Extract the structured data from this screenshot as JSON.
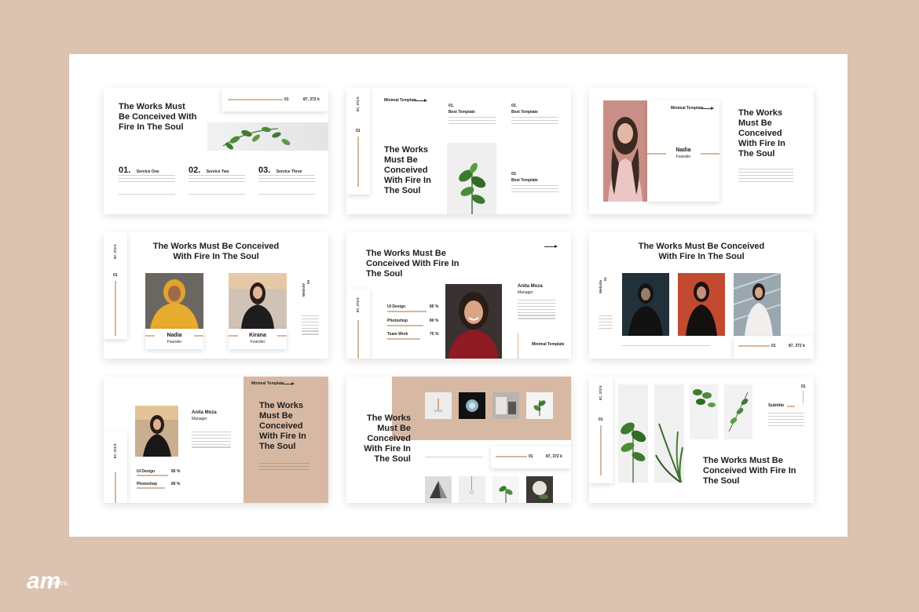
{
  "colors": {
    "background": "#dcc2b0",
    "accent": "#d8b79a",
    "board": "#ffffff"
  },
  "logo": {
    "text": "am",
    "sub": "slides."
  },
  "common": {
    "title_full": "The Works Must Be Conceived With Fire In The Soul",
    "minimal_template": "Minimal Template",
    "stat": "87, 372 k",
    "stat_short": "01"
  },
  "s1": {
    "title": "The Works Must Be Conceived With Fire In The Soul",
    "stat": "87, 372 k",
    "stat_small": "01",
    "services": [
      {
        "num": "01.",
        "label": "Service One"
      },
      {
        "num": "02.",
        "label": "Service Two"
      },
      {
        "num": "03.",
        "label": "Service Three"
      }
    ]
  },
  "s2": {
    "title": "The Works Must Be Conceived With Fire In The Soul",
    "header": "Minimal Template",
    "side_stat": "87, 372 k",
    "side_num": "01",
    "items": [
      {
        "num": "01.",
        "label": "Best Template"
      },
      {
        "num": "02.",
        "label": "Best Template"
      },
      {
        "num": "03.",
        "label": "Best Template"
      }
    ]
  },
  "s3": {
    "title": "The Works Must Be Conceived With Fire In The Soul",
    "header": "Minimal Template",
    "name": "Nadia",
    "role": "Founder"
  },
  "s4": {
    "title": "The Works Must Be Conceived With Fire In The Soul",
    "side_stat": "87, 372 k",
    "side_num": "01",
    "right_label": "Website",
    "right_num": "05",
    "people": [
      {
        "name": "Nadia",
        "role": "Founder"
      },
      {
        "name": "Kirana",
        "role": "Founder"
      }
    ]
  },
  "s5": {
    "title": "The Works Must Be Conceived With Fire In The Soul",
    "name": "Anita Moza",
    "role": "Manager",
    "side_stat": "87, 372 k",
    "footer": "Minimal Template",
    "skills": [
      {
        "label": "UI Design",
        "value": "85 %"
      },
      {
        "label": "Photoshop",
        "value": "80 %"
      },
      {
        "label": "Team Work",
        "value": "75 %"
      }
    ]
  },
  "s6": {
    "title": "The Works Must Be Conceived With Fire In The Soul",
    "side_label": "Website",
    "side_num": "01",
    "stat": "87, 372 k",
    "stat_small": "01"
  },
  "s7": {
    "title": "The Works Must Be Conceived With Fire In The Soul",
    "header": "Minimal Template",
    "name": "Anita Moza",
    "role": "Manager",
    "side_stat": "87, 372 k",
    "skills": [
      {
        "label": "UI Design",
        "value": "85 %"
      },
      {
        "label": "Photoshop",
        "value": "80 %"
      }
    ]
  },
  "s8": {
    "title": "The Works Must Be Conceived With Fire In The Soul",
    "stat": "87, 372 k",
    "stat_small": "01"
  },
  "s9": {
    "title": "The Works Must Be Conceived With Fire In The Soul",
    "subtitle": "Subtitle",
    "side_stat": "87, 372 k",
    "side_num": "01",
    "corner_num": "01"
  }
}
